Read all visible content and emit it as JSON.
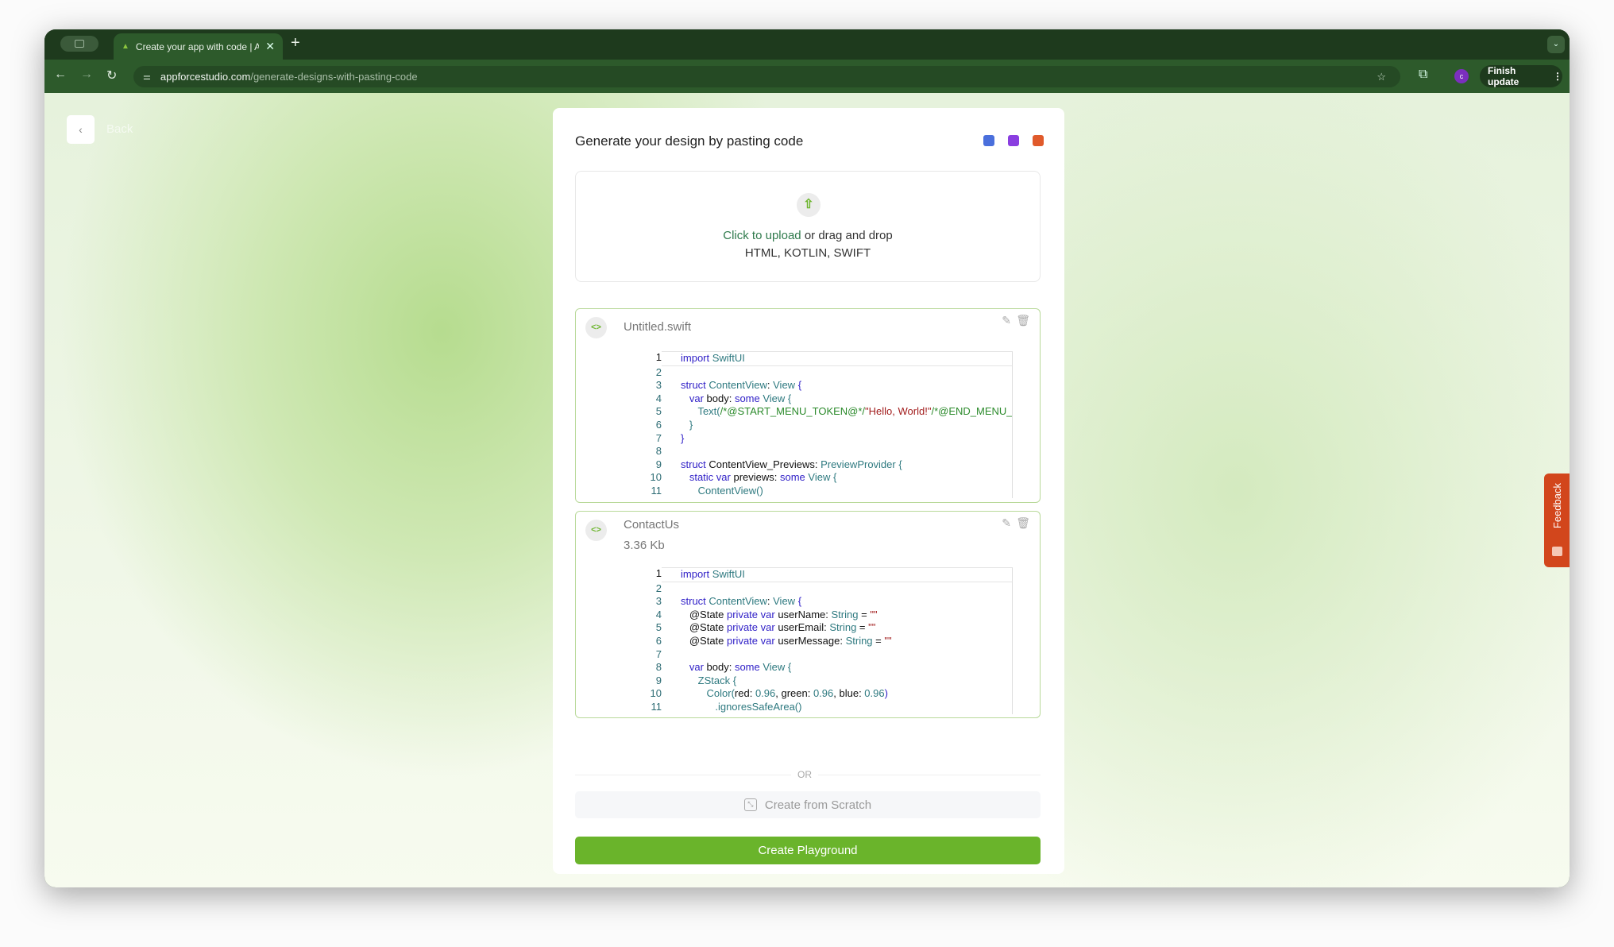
{
  "browser": {
    "tab_title": "Create your app with code | A",
    "url_host": "appforcestudio.com",
    "url_path": "/generate-designs-with-pasting-code",
    "avatar_letter": "c",
    "finish_update": "Finish update"
  },
  "page": {
    "back_label": "Back",
    "title": "Generate your design by pasting code",
    "lang_icons": [
      {
        "name": "html-icon",
        "color": "#4a6fdc"
      },
      {
        "name": "kotlin-icon",
        "color": "#8a3ee0"
      },
      {
        "name": "swift-icon",
        "color": "#e05a2b"
      }
    ],
    "upload": {
      "link": "Click to upload",
      "rest": " or drag and drop",
      "formats": "HTML, KOTLIN, SWIFT"
    },
    "files": [
      {
        "name": "Untitled.swift",
        "size": "",
        "lines": [
          [
            [
              "k",
              "import"
            ],
            [
              "t",
              " SwiftUI"
            ]
          ],
          [],
          [
            [
              "k",
              "struct"
            ],
            [
              "t",
              " ContentView"
            ],
            [
              "p",
              ": "
            ],
            [
              "t",
              "View"
            ],
            [
              "k",
              " {"
            ]
          ],
          [
            [
              "p",
              "   "
            ],
            [
              "k",
              "var"
            ],
            [
              "p",
              " body: "
            ],
            [
              "k",
              "some"
            ],
            [
              "t",
              " View {"
            ]
          ],
          [
            [
              "p",
              "      "
            ],
            [
              "t",
              "Text("
            ],
            [
              "m",
              "/*@START_MENU_TOKEN@*/"
            ],
            [
              "s",
              "\"Hello, World!\""
            ],
            [
              "m",
              "/*@END_MENU_TOKEN@*/"
            ]
          ],
          [
            [
              "p",
              "   "
            ],
            [
              "t",
              "}"
            ]
          ],
          [
            [
              "k",
              "}"
            ]
          ],
          [],
          [
            [
              "k",
              "struct"
            ],
            [
              "p",
              " ContentView_Previews: "
            ],
            [
              "t",
              "PreviewProvider {"
            ]
          ],
          [
            [
              "p",
              "   "
            ],
            [
              "k",
              "static var"
            ],
            [
              "p",
              " previews: "
            ],
            [
              "k",
              "some"
            ],
            [
              "t",
              " View {"
            ]
          ],
          [
            [
              "p",
              "      "
            ],
            [
              "t",
              "ContentView()"
            ]
          ]
        ]
      },
      {
        "name": "ContactUs",
        "size": "3.36 Kb",
        "lines": [
          [
            [
              "k",
              "import"
            ],
            [
              "t",
              " SwiftUI"
            ]
          ],
          [],
          [
            [
              "k",
              "struct"
            ],
            [
              "t",
              " ContentView"
            ],
            [
              "p",
              ": "
            ],
            [
              "t",
              "View"
            ],
            [
              "k",
              " {"
            ]
          ],
          [
            [
              "p",
              "   @State "
            ],
            [
              "k",
              "private var"
            ],
            [
              "p",
              " userName: "
            ],
            [
              "t",
              "String"
            ],
            [
              "p",
              " = "
            ],
            [
              "s",
              "\"\""
            ]
          ],
          [
            [
              "p",
              "   @State "
            ],
            [
              "k",
              "private var"
            ],
            [
              "p",
              " userEmail: "
            ],
            [
              "t",
              "String"
            ],
            [
              "p",
              " = "
            ],
            [
              "s",
              "\"\""
            ]
          ],
          [
            [
              "p",
              "   @State "
            ],
            [
              "k",
              "private var"
            ],
            [
              "p",
              " userMessage: "
            ],
            [
              "t",
              "String"
            ],
            [
              "p",
              " = "
            ],
            [
              "s",
              "\"\""
            ]
          ],
          [],
          [
            [
              "p",
              "   "
            ],
            [
              "k",
              "var"
            ],
            [
              "p",
              " body: "
            ],
            [
              "k",
              "some"
            ],
            [
              "t",
              " View {"
            ]
          ],
          [
            [
              "p",
              "      "
            ],
            [
              "t",
              "ZStack {"
            ]
          ],
          [
            [
              "p",
              "         "
            ],
            [
              "t",
              "Color("
            ],
            [
              "p",
              "red: "
            ],
            [
              "t",
              "0.96"
            ],
            [
              "p",
              ", green: "
            ],
            [
              "t",
              "0.96"
            ],
            [
              "p",
              ", blue: "
            ],
            [
              "t",
              "0.96"
            ],
            [
              "k",
              ")"
            ]
          ],
          [
            [
              "p",
              "            "
            ],
            [
              "t",
              ".ignoresSafeArea()"
            ]
          ]
        ]
      }
    ],
    "or": "OR",
    "create_scratch": "Create from Scratch",
    "create_playground": "Create Playground",
    "feedback": "Feedback"
  }
}
